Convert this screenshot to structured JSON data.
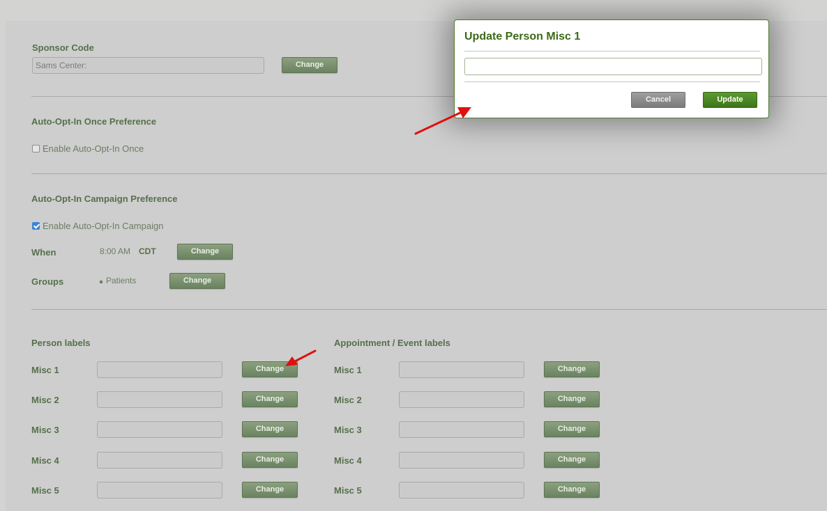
{
  "sponsor": {
    "title": "Sponsor Code",
    "value": "Sams Center:",
    "change_label": "Change"
  },
  "auto_once": {
    "title": "Auto-Opt-In Once Preference",
    "checkbox_label": "Enable Auto-Opt-In Once",
    "checked": false
  },
  "auto_campaign": {
    "title": "Auto-Opt-In Campaign Preference",
    "checkbox_label": "Enable Auto-Opt-In Campaign",
    "checked": true,
    "when_label": "When",
    "when_time": "8:00 AM",
    "when_tz": "CDT",
    "when_change": "Change",
    "groups_label": "Groups",
    "groups_value": "Patients",
    "groups_change": "Change"
  },
  "person_labels": {
    "title": "Person labels",
    "rows": [
      {
        "label": "Misc 1",
        "change": "Change"
      },
      {
        "label": "Misc 2",
        "change": "Change"
      },
      {
        "label": "Misc 3",
        "change": "Change"
      },
      {
        "label": "Misc 4",
        "change": "Change"
      },
      {
        "label": "Misc 5",
        "change": "Change"
      }
    ]
  },
  "event_labels": {
    "title": "Appointment / Event labels",
    "rows": [
      {
        "label": "Misc 1",
        "change": "Change"
      },
      {
        "label": "Misc 2",
        "change": "Change"
      },
      {
        "label": "Misc 3",
        "change": "Change"
      },
      {
        "label": "Misc 4",
        "change": "Change"
      },
      {
        "label": "Misc 5",
        "change": "Change"
      }
    ]
  },
  "modal": {
    "title": "Update Person Misc 1",
    "input_value": "",
    "cancel_label": "Cancel",
    "update_label": "Update"
  },
  "colors": {
    "accent_green": "#55704a",
    "modal_title": "#3c6a16",
    "arrow": "#e01010"
  }
}
